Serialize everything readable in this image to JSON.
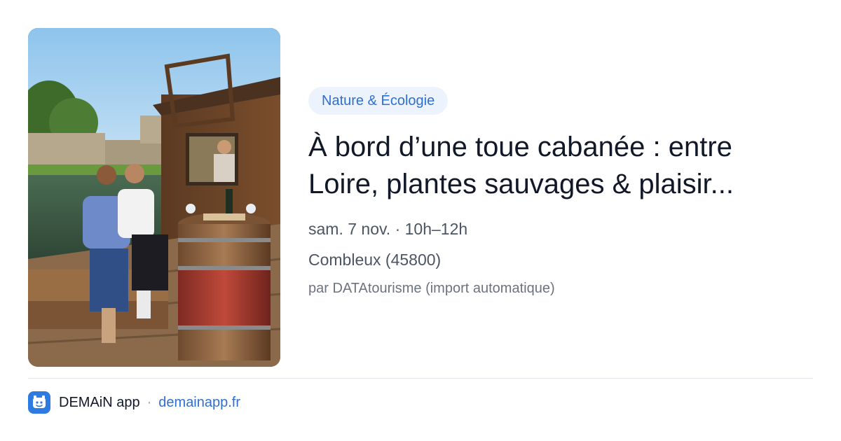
{
  "event": {
    "category": "Nature & Écologie",
    "title": "À bord d’une toue cabanée : entre Loire, plantes sauvages & plaisir...",
    "datetime": "sam. 7 nov. · 10h–12h",
    "location": "Combleux (45800)",
    "source": "par DATAtourisme (import automatique)"
  },
  "footer": {
    "app_name": "DEMAiN app",
    "separator": "·",
    "link": "demainapp.fr"
  },
  "colors": {
    "accent": "#2f6fd0",
    "tag_background": "#edf3fc",
    "title": "#111827",
    "meta": "#4b5563",
    "app_icon": "#2d7be0"
  },
  "icons": {
    "app": "demain-app-icon"
  }
}
